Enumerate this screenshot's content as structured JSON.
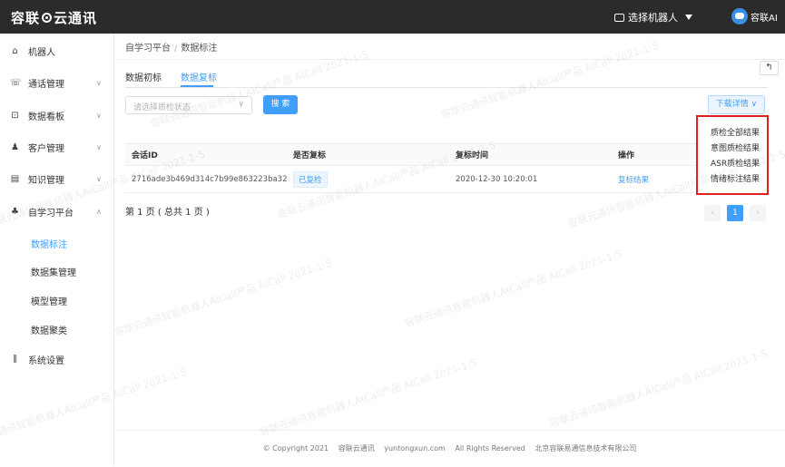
{
  "header": {
    "logo_text_left": "容联",
    "logo_text_right": "云通讯",
    "robot_select": "选择机器人",
    "user_name": "容联AI"
  },
  "sidebar": {
    "items": [
      {
        "label": "机器人",
        "icon": "robot-icon",
        "glyph": "⌂"
      },
      {
        "label": "通话管理",
        "icon": "phone-icon",
        "glyph": "☏",
        "arrow": "∨"
      },
      {
        "label": "数据看板",
        "icon": "chart-icon",
        "glyph": "⊡",
        "arrow": "∨"
      },
      {
        "label": "客户管理",
        "icon": "users-icon",
        "glyph": "♟",
        "arrow": "∨"
      },
      {
        "label": "知识管理",
        "icon": "book-icon",
        "glyph": "▤",
        "arrow": "∨"
      },
      {
        "label": "自学习平台",
        "icon": "learning-icon",
        "glyph": "♣",
        "arrow": "∧"
      },
      {
        "label": "系统设置",
        "icon": "settings-icon",
        "glyph": "⫼"
      }
    ],
    "sub_items": [
      {
        "label": "数据标注",
        "active": true
      },
      {
        "label": "数据集管理"
      },
      {
        "label": "模型管理"
      },
      {
        "label": "数据聚类"
      }
    ]
  },
  "breadcrumb": {
    "root": "自学习平台",
    "sep": "/",
    "current": "数据标注"
  },
  "back_glyph": "↰",
  "tabs": [
    {
      "label": "数据初标"
    },
    {
      "label": "数据复标",
      "active": true
    }
  ],
  "filter": {
    "placeholder": "请选择质检状态",
    "chevron": "∨",
    "search_label": "搜 索",
    "download_label": "下载详情 ∨"
  },
  "table": {
    "headers": [
      "会话ID",
      "是否复标",
      "复标时间",
      "操作"
    ],
    "rows": [
      {
        "id": "2716ade3b469d314c7b99e863223ba32",
        "status": "已复检",
        "time": "2020-12-30 10:20:01",
        "action": "复标结果"
      }
    ]
  },
  "pagination": {
    "text": "第 1 页 ( 总共 1 页 )",
    "prev": "‹",
    "current": "1",
    "next": "›"
  },
  "dropdown": {
    "items": [
      "质检全部结果",
      "意图质检结果",
      "ASR质检结果",
      "情绪标注结果"
    ]
  },
  "footer": {
    "copyright": "© Copyright 2021",
    "company": "容联云通讯",
    "domain": "yuntongxun.com",
    "rights": "All Rights Reserved",
    "full_name": "北京容联易通信息技术有限公司"
  },
  "watermark": {
    "text": "容联云通讯智能机器人AICall产品 AICall 2021-1-5"
  },
  "colors": {
    "accent": "#409eff",
    "topbar": "#2b2b2b",
    "highlight_border": "#e02020"
  }
}
